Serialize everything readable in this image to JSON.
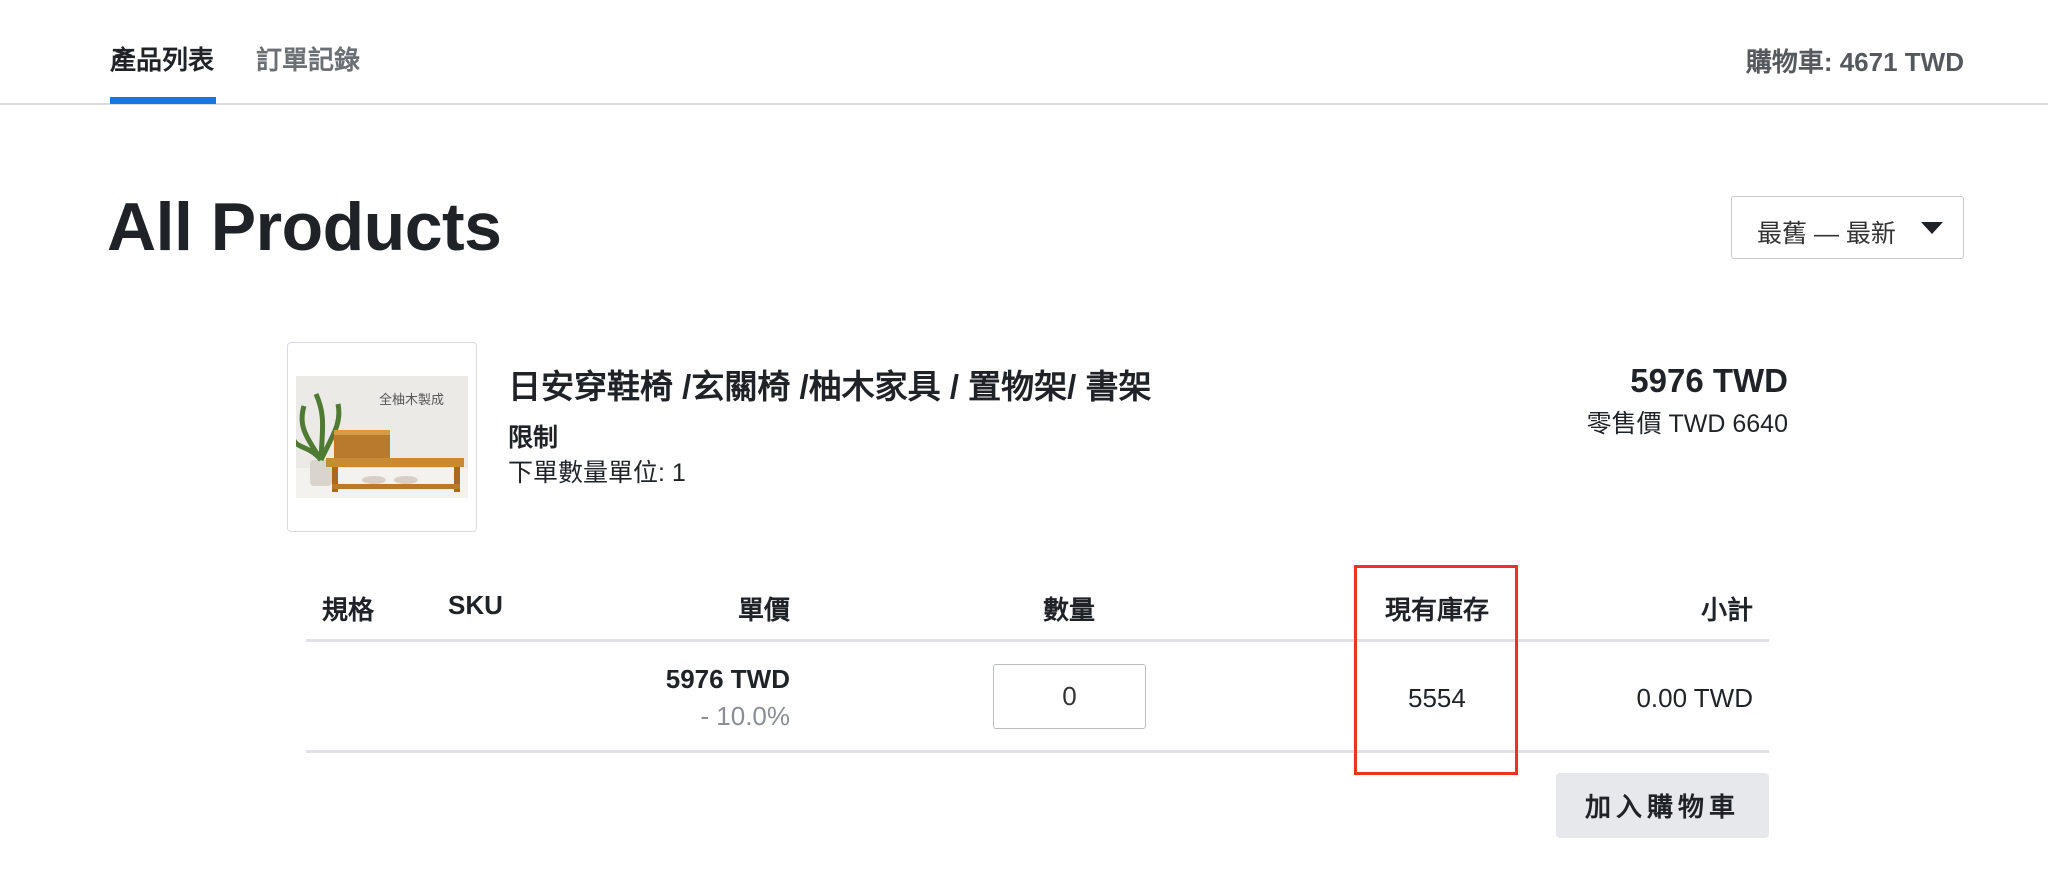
{
  "nav": {
    "tabs": [
      {
        "label": "產品列表",
        "active": true
      },
      {
        "label": "訂單記錄",
        "active": false
      }
    ],
    "cart_total": "購物車: 4671 TWD"
  },
  "page": {
    "title": "All Products",
    "sort": {
      "selected": "最舊 — 最新",
      "icon": "caret-down-icon"
    }
  },
  "product": {
    "image_text": "全柚木製成",
    "name": "日安穿鞋椅 /玄關椅 /柚木家具 / 置物架/ 書架",
    "restriction": "限制",
    "order_unit": "下單數量單位: 1",
    "price": "5976 TWD",
    "retail_price": "零售價 TWD 6640"
  },
  "table": {
    "headers": {
      "spec": "規格",
      "sku": "SKU",
      "unit_price": "單價",
      "quantity": "數量",
      "stock": "現有庫存",
      "subtotal": "小計"
    },
    "row": {
      "spec": "",
      "sku": "",
      "unit_price": "5976 TWD",
      "discount": "- 10.0%",
      "quantity": "0",
      "stock": "5554",
      "subtotal": "0.00 TWD"
    }
  },
  "actions": {
    "add_to_cart": "加入購物車"
  },
  "colors": {
    "accent": "#1a73e8",
    "highlight": "#ea3323"
  }
}
